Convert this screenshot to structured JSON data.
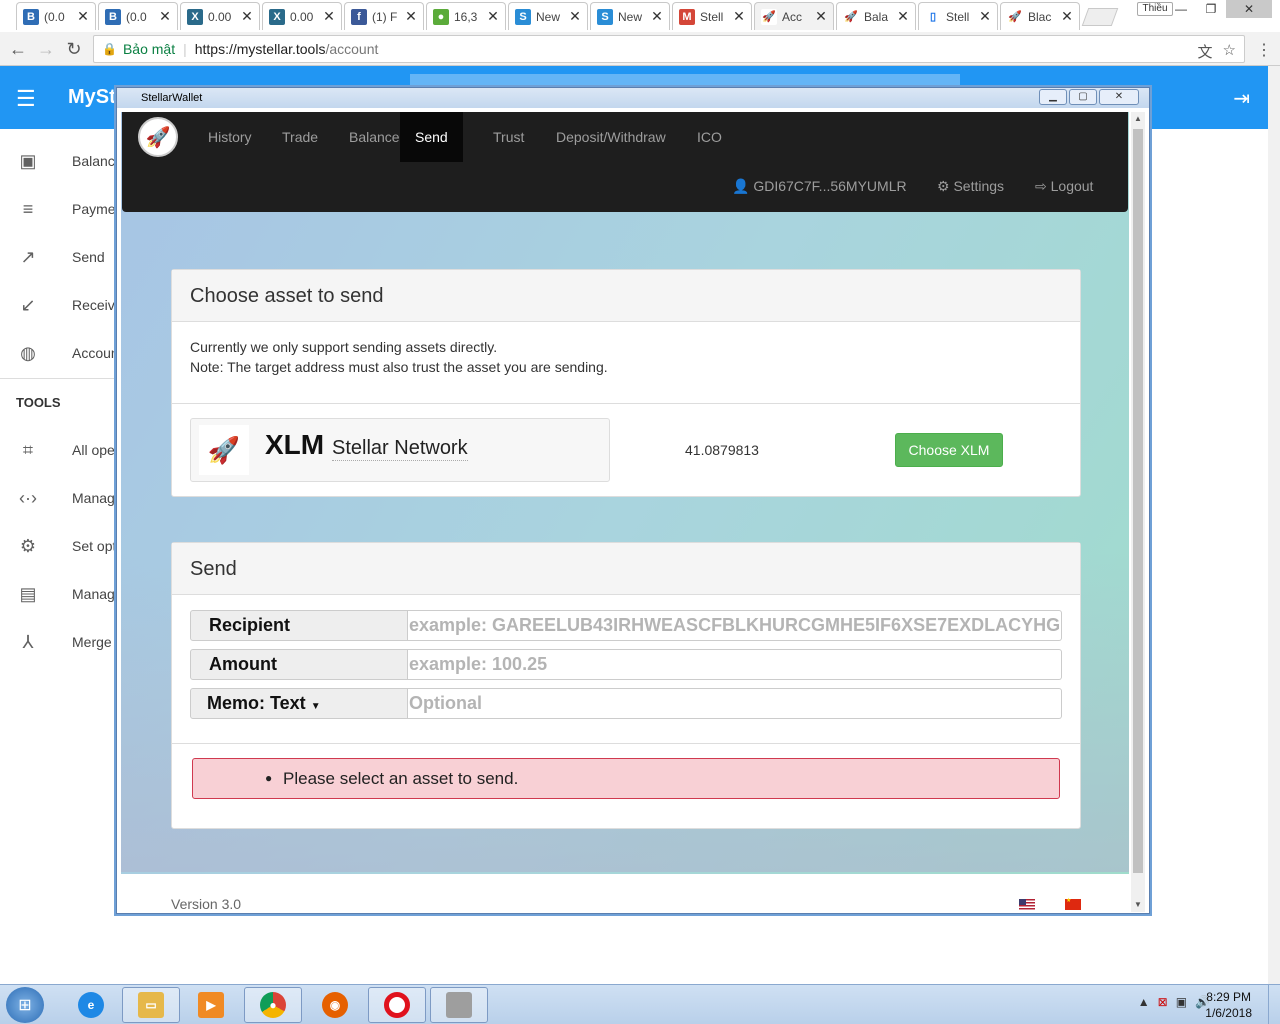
{
  "browser": {
    "tabs": [
      {
        "label": "(0.0",
        "favicon": "B",
        "color": "#2f6db5"
      },
      {
        "label": "(0.0",
        "favicon": "B",
        "color": "#2f6db5"
      },
      {
        "label": "0.00",
        "favicon": "X",
        "color": "#2a6a8a"
      },
      {
        "label": "0.00",
        "favicon": "X",
        "color": "#2a6a8a"
      },
      {
        "label": "(1) F",
        "favicon": "f",
        "color": "#3b5998"
      },
      {
        "label": "16,3",
        "favicon": "●",
        "color": "#5bab3a"
      },
      {
        "label": "New",
        "favicon": "S",
        "color": "#2a8dd6"
      },
      {
        "label": "New",
        "favicon": "S",
        "color": "#2a8dd6"
      },
      {
        "label": "Stell",
        "favicon": "M",
        "color": "#d44638"
      },
      {
        "label": "Acc",
        "favicon": "🚀",
        "color": "#ffffff"
      },
      {
        "label": "Bala",
        "favicon": "🚀",
        "color": "#ffffff"
      },
      {
        "label": "Stell",
        "favicon": "▯",
        "color": "#ffffff"
      },
      {
        "label": "Blac",
        "favicon": "🚀",
        "color": "#ffffff"
      }
    ],
    "active_tab_index": 9,
    "close_glyph": "✕",
    "user_chip": "Thiều",
    "secure_label": "Bảo mật",
    "url_host": "https://mystellar.tools",
    "url_path": "/account",
    "window_controls": {
      "minimize": "—",
      "maximize": "❐",
      "close": "✕"
    }
  },
  "page": {
    "brand": "MySt",
    "sidebar": [
      {
        "label": "Balance",
        "icon": "wallet-icon",
        "glyph": "▣"
      },
      {
        "label": "Payme",
        "icon": "list-icon",
        "glyph": "≡"
      },
      {
        "label": "Send",
        "icon": "arrow-up-right-icon",
        "glyph": "↗"
      },
      {
        "label": "Receive",
        "icon": "arrow-down-left-icon",
        "glyph": "↙"
      },
      {
        "label": "Accoun",
        "icon": "globe-icon",
        "glyph": "◍"
      }
    ],
    "tools_heading": "TOOLS",
    "tools": [
      {
        "label": "All ope",
        "icon": "crop-icon",
        "glyph": "⌗"
      },
      {
        "label": "Manag",
        "icon": "code-icon",
        "glyph": "‹·›"
      },
      {
        "label": "Set opt",
        "icon": "gear-icon",
        "glyph": "⚙"
      },
      {
        "label": "Manag",
        "icon": "server-icon",
        "glyph": "▤"
      },
      {
        "label": "Merge",
        "icon": "merge-icon",
        "glyph": "⅄"
      }
    ]
  },
  "popup": {
    "title": "StellarWallet",
    "nav": [
      "History",
      "Trade",
      "Balance",
      "Send",
      "Trust",
      "Deposit/Withdraw",
      "ICO"
    ],
    "active_nav": "Send",
    "account": "GDI67C7F...56MYUMLR",
    "settings": "Settings",
    "logout": "Logout",
    "choose_panel": {
      "heading": "Choose asset to send",
      "line1": "Currently we only support sending assets directly.",
      "line2": "Note: The target address must also trust the asset you are sending.",
      "asset_code": "XLM",
      "asset_issuer": "Stellar Network",
      "balance": "41.0879813",
      "button": "Choose XLM"
    },
    "send_panel": {
      "heading": "Send",
      "recipient_label": "Recipient",
      "recipient_placeholder": "example: GAREELUB43IRHWEASCFBLKHURCGMHE5IF6XSE7EXDLACYHG",
      "amount_label": "Amount",
      "amount_placeholder": "example: 100.25",
      "memo_label": "Memo: Text",
      "memo_placeholder": "Optional",
      "error": "Please select an asset to send."
    },
    "version": "Version 3.0"
  },
  "taskbar": {
    "time": "8:29 PM",
    "date": "1/6/2018"
  }
}
